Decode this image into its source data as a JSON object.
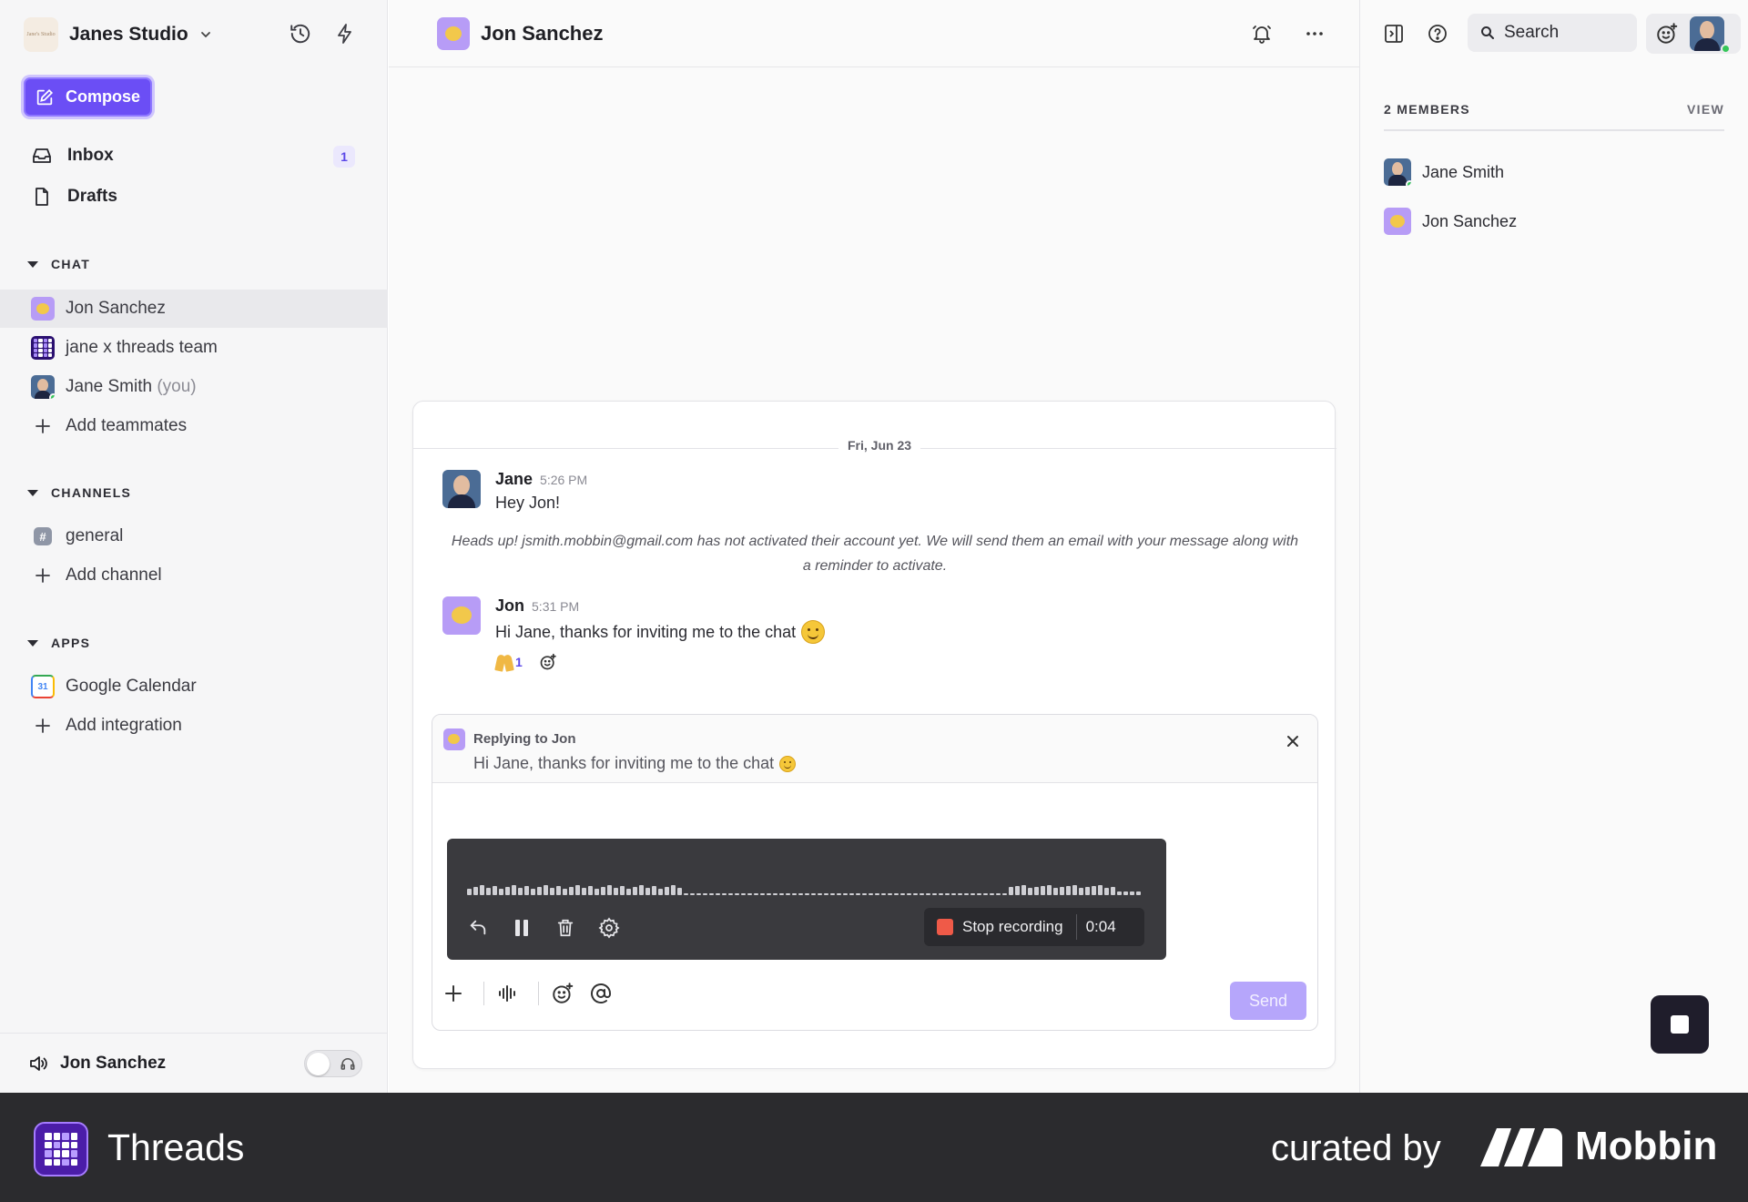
{
  "workspace": {
    "name": "Janes Studio",
    "logo_text": "Jane's Studio"
  },
  "compose": {
    "label": "Compose"
  },
  "nav": {
    "inbox": {
      "label": "Inbox",
      "badge": "1"
    },
    "drafts": {
      "label": "Drafts"
    }
  },
  "sections": {
    "chat": {
      "title": "CHAT",
      "items": [
        {
          "label": "Jon Sanchez"
        },
        {
          "label": "jane x threads team"
        },
        {
          "label": "Jane Smith",
          "suffix": "(you)"
        }
      ],
      "add_label": "Add teammates"
    },
    "channels": {
      "title": "CHANNELS",
      "items": [
        {
          "label": "general"
        }
      ],
      "add_label": "Add channel"
    },
    "apps": {
      "title": "APPS",
      "items": [
        {
          "label": "Google Calendar",
          "icon_text": "31"
        }
      ],
      "add_label": "Add integration"
    }
  },
  "footer_user": {
    "name": "Jon Sanchez"
  },
  "conversation": {
    "title": "Jon Sanchez",
    "date": "Fri, Jun 23",
    "messages": [
      {
        "author": "Jane",
        "time": "5:26 PM",
        "text": "Hey Jon!"
      },
      {
        "author": "Jon",
        "time": "5:31 PM",
        "text": "Hi Jane, thanks for inviting me to the chat"
      }
    ],
    "notice": "Heads up! jsmith.mobbin@gmail.com has not activated their account yet. We will send them an email with your message along with a reminder to activate.",
    "reaction": {
      "emoji": "folded-hands",
      "count": "1"
    }
  },
  "composer": {
    "reply_title": "Replying to Jon",
    "reply_text": "Hi Jane, thanks for inviting me to the chat",
    "recording": {
      "stop_label": "Stop recording",
      "duration": "0:04"
    },
    "send_label": "Send"
  },
  "right_panel": {
    "search_label": "Search",
    "members_title": "2 MEMBERS",
    "view_label": "VIEW",
    "members": [
      {
        "name": "Jane Smith"
      },
      {
        "name": "Jon Sanchez"
      }
    ]
  },
  "brand_footer": {
    "app_name": "Threads",
    "curated": "curated by",
    "brand": "Mobbin"
  },
  "colors": {
    "accent": "#6b4ef5",
    "recording_bg": "#3a3a3e",
    "stop_red": "#ef5a48",
    "online": "#35c759"
  }
}
